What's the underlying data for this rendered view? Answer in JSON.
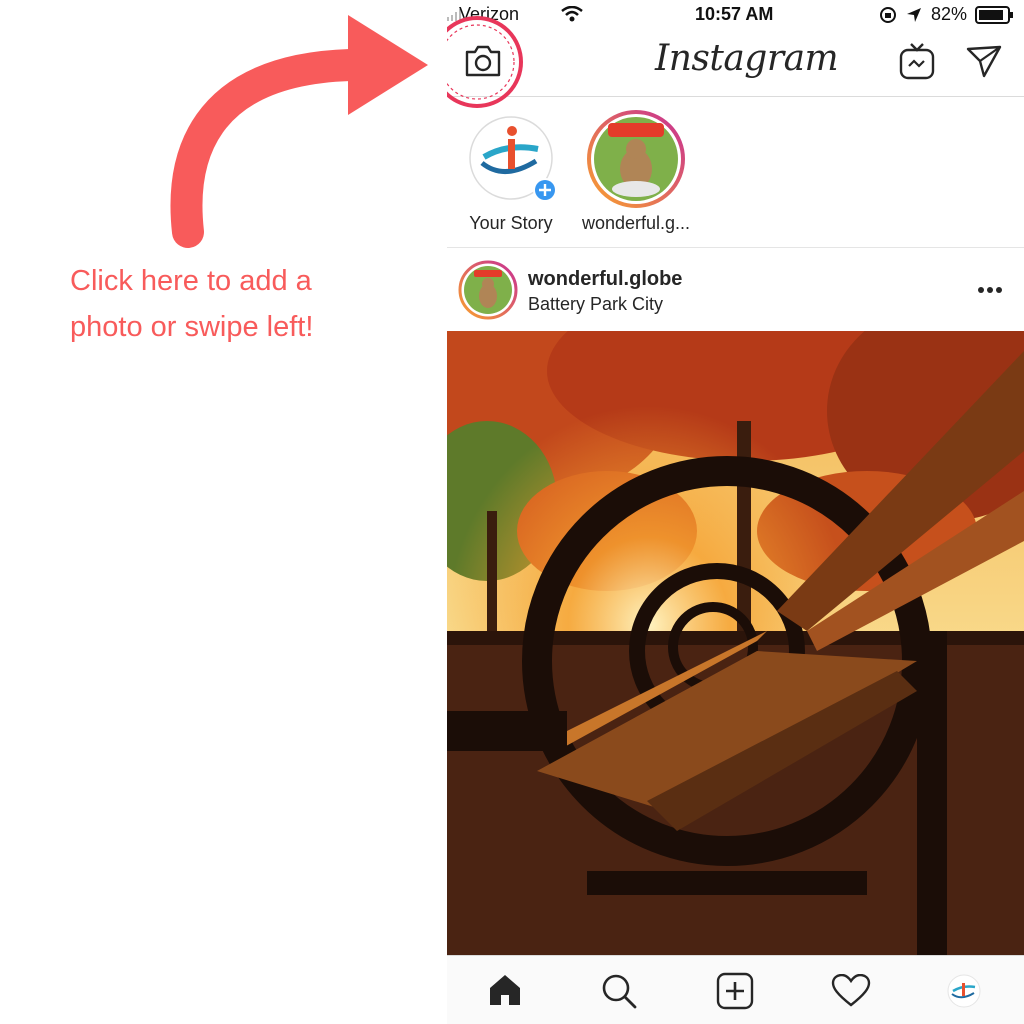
{
  "annotation": {
    "line1": "Click here to add a",
    "line2": "photo or swipe left!",
    "color": "#f85b5b"
  },
  "status_bar": {
    "carrier": "Verizon",
    "time": "10:57 AM",
    "battery": "82%"
  },
  "header": {
    "title": "Instagram",
    "icons": [
      "camera-icon",
      "igtv-icon",
      "direct-message-icon"
    ]
  },
  "stories": [
    {
      "label": "Your Story"
    },
    {
      "label": "wonderful.g..."
    }
  ],
  "post": {
    "username": "wonderful.globe",
    "location": "Battery Park City",
    "more_icon": "more-options-icon"
  },
  "tab_bar": {
    "icons": [
      "home-icon",
      "search-icon",
      "add-post-icon",
      "activity-heart-icon",
      "profile-avatar-icon"
    ]
  },
  "colors": {
    "highlight": "#e8365a",
    "story_ring_start": "#f9a12e",
    "story_ring_end": "#c72f94",
    "add_badge": "#3897f0"
  }
}
